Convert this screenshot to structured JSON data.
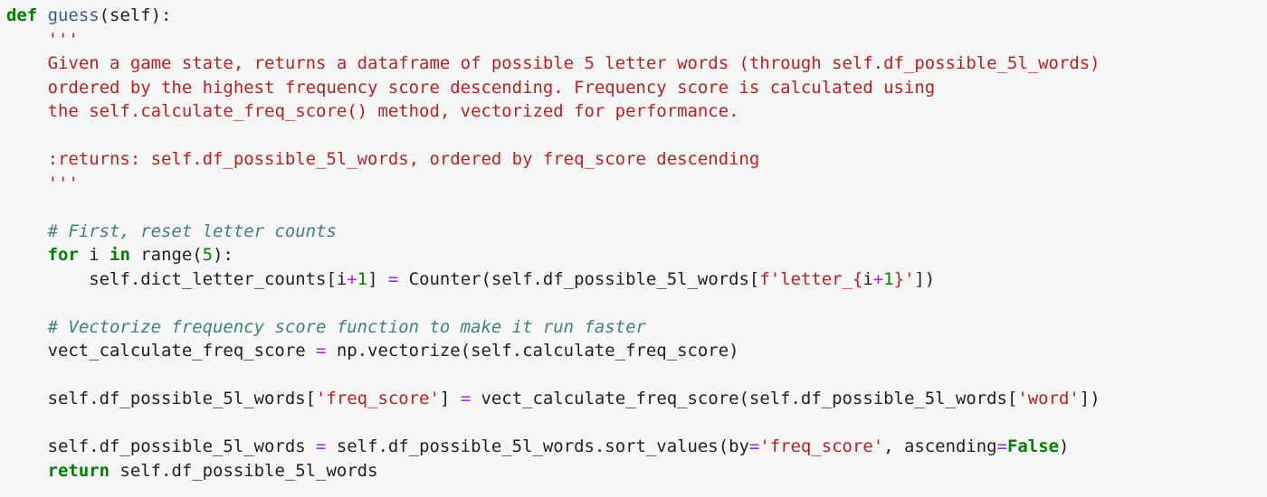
{
  "colors": {
    "background": "#f7f7f7",
    "text": "#212121",
    "keyword": "#008000",
    "string": "#ba2121",
    "comment": "#408080",
    "operator": "#aa22ff",
    "number": "#008000",
    "function_name": "#3b5998"
  },
  "code": {
    "lines": [
      [
        {
          "t": "kw",
          "v": "def"
        },
        {
          "t": "txt",
          "v": " "
        },
        {
          "t": "fn",
          "v": "guess"
        },
        {
          "t": "txt",
          "v": "(self):"
        }
      ],
      [
        {
          "t": "txt",
          "v": "    "
        },
        {
          "t": "doc",
          "v": "'''"
        }
      ],
      [
        {
          "t": "txt",
          "v": "    "
        },
        {
          "t": "doc",
          "v": "Given a game state, returns a dataframe of possible 5 letter words (through self.df_possible_5l_words)"
        }
      ],
      [
        {
          "t": "txt",
          "v": "    "
        },
        {
          "t": "doc",
          "v": "ordered by the highest frequency score descending. Frequency score is calculated using"
        }
      ],
      [
        {
          "t": "txt",
          "v": "    "
        },
        {
          "t": "doc",
          "v": "the self.calculate_freq_score() method, vectorized for performance."
        }
      ],
      [],
      [
        {
          "t": "txt",
          "v": "    "
        },
        {
          "t": "doc",
          "v": ":returns: self.df_possible_5l_words, ordered by freq_score descending"
        }
      ],
      [
        {
          "t": "txt",
          "v": "    "
        },
        {
          "t": "doc",
          "v": "'''"
        }
      ],
      [],
      [
        {
          "t": "txt",
          "v": "    "
        },
        {
          "t": "cmt",
          "v": "# First, reset letter counts"
        }
      ],
      [
        {
          "t": "txt",
          "v": "    "
        },
        {
          "t": "kw",
          "v": "for"
        },
        {
          "t": "txt",
          "v": " i "
        },
        {
          "t": "kw",
          "v": "in"
        },
        {
          "t": "txt",
          "v": " range("
        },
        {
          "t": "num",
          "v": "5"
        },
        {
          "t": "txt",
          "v": "):"
        }
      ],
      [
        {
          "t": "txt",
          "v": "        self.dict_letter_counts[i"
        },
        {
          "t": "op",
          "v": "+"
        },
        {
          "t": "num",
          "v": "1"
        },
        {
          "t": "txt",
          "v": "] "
        },
        {
          "t": "op",
          "v": "="
        },
        {
          "t": "txt",
          "v": " Counter(self.df_possible_5l_words["
        },
        {
          "t": "str",
          "v": "f'letter_{"
        },
        {
          "t": "txt",
          "v": "i"
        },
        {
          "t": "op",
          "v": "+"
        },
        {
          "t": "num",
          "v": "1"
        },
        {
          "t": "str",
          "v": "}'"
        },
        {
          "t": "txt",
          "v": "])"
        }
      ],
      [],
      [
        {
          "t": "txt",
          "v": "    "
        },
        {
          "t": "cmt",
          "v": "# Vectorize frequency score function to make it run faster"
        }
      ],
      [
        {
          "t": "txt",
          "v": "    vect_calculate_freq_score "
        },
        {
          "t": "op",
          "v": "="
        },
        {
          "t": "txt",
          "v": " np.vectorize(self.calculate_freq_score)"
        }
      ],
      [],
      [
        {
          "t": "txt",
          "v": "    self.df_possible_5l_words["
        },
        {
          "t": "str",
          "v": "'freq_score'"
        },
        {
          "t": "txt",
          "v": "] "
        },
        {
          "t": "op",
          "v": "="
        },
        {
          "t": "txt",
          "v": " vect_calculate_freq_score(self.df_possible_5l_words["
        },
        {
          "t": "str",
          "v": "'word'"
        },
        {
          "t": "txt",
          "v": "])"
        }
      ],
      [],
      [
        {
          "t": "txt",
          "v": "    self.df_possible_5l_words "
        },
        {
          "t": "op",
          "v": "="
        },
        {
          "t": "txt",
          "v": " self.df_possible_5l_words.sort_values(by"
        },
        {
          "t": "op",
          "v": "="
        },
        {
          "t": "str",
          "v": "'freq_score'"
        },
        {
          "t": "txt",
          "v": ", ascending"
        },
        {
          "t": "op",
          "v": "="
        },
        {
          "t": "kw",
          "v": "False"
        },
        {
          "t": "txt",
          "v": ")"
        }
      ],
      [
        {
          "t": "txt",
          "v": "    "
        },
        {
          "t": "kw",
          "v": "return"
        },
        {
          "t": "txt",
          "v": " self.df_possible_5l_words"
        }
      ]
    ]
  }
}
